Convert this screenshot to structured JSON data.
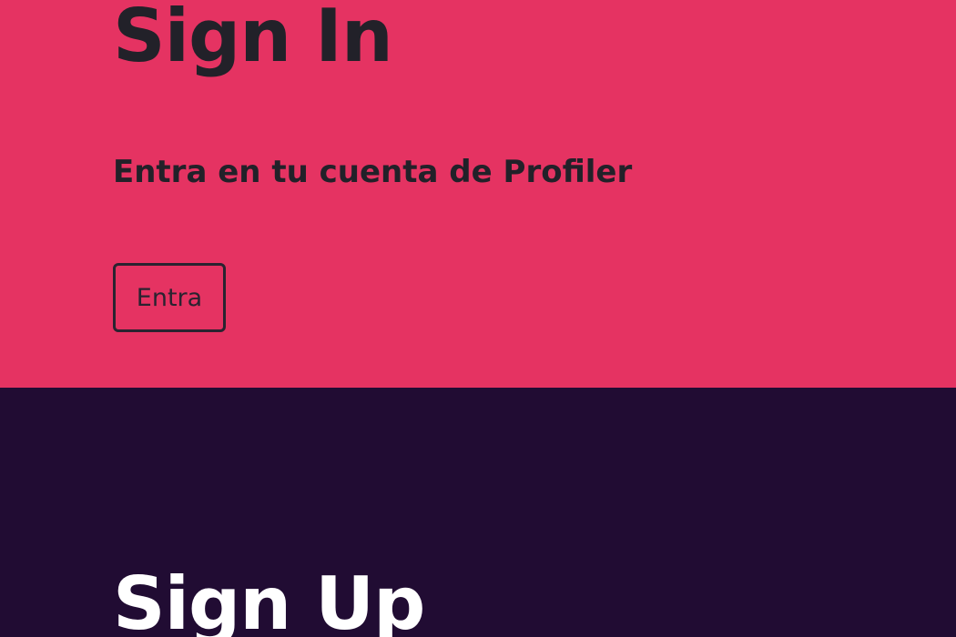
{
  "signin": {
    "title": "Sign In",
    "subtitle": "Entra en tu cuenta de Profiler",
    "button_label": "Entra",
    "bg_color": "#e53362",
    "text_color": "#222129"
  },
  "signup": {
    "title": "Sign Up",
    "bg_color": "#210c33",
    "text_color": "#ffffff"
  }
}
